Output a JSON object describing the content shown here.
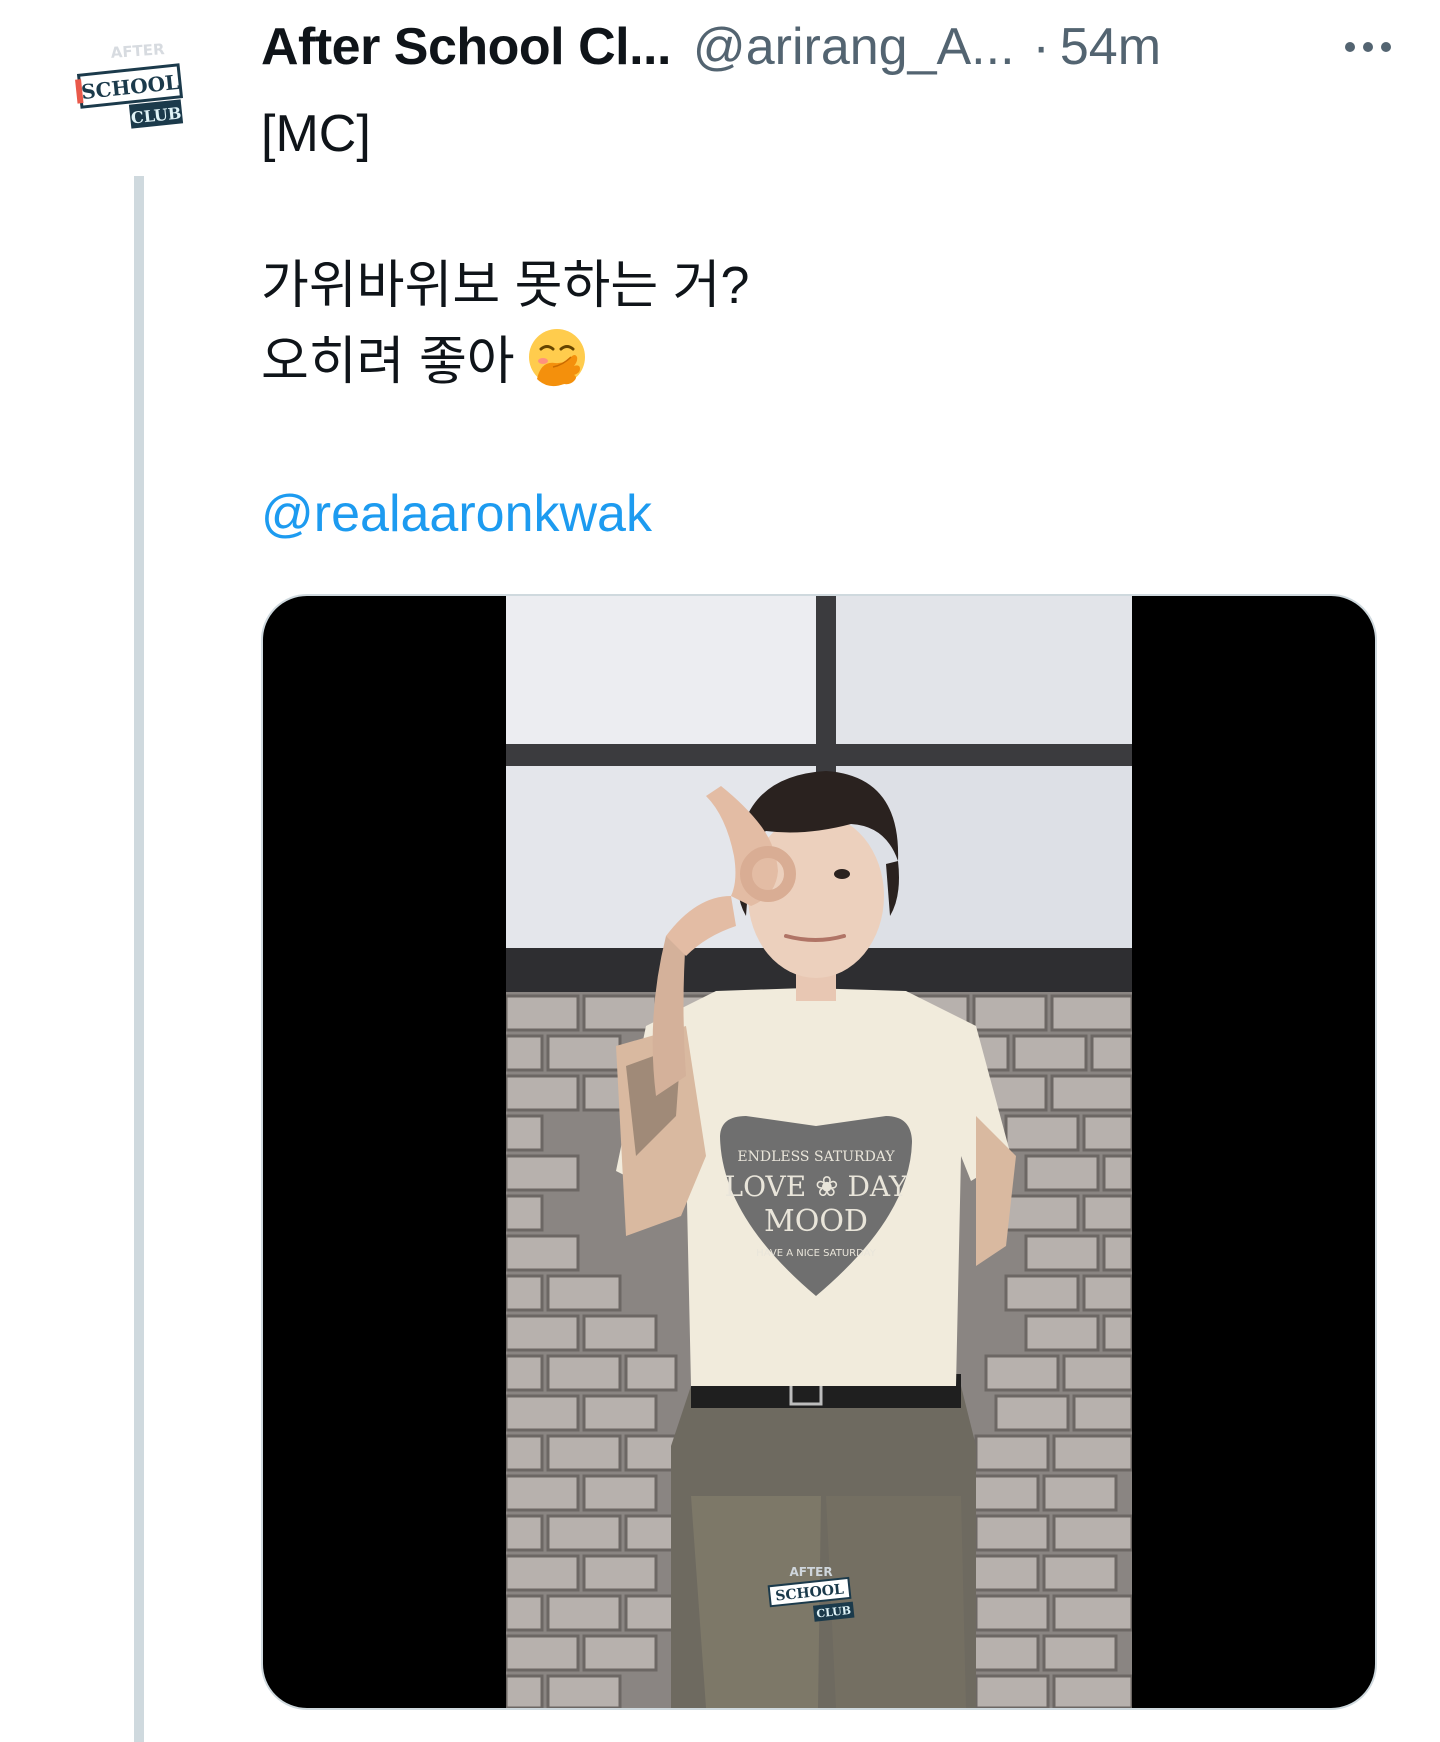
{
  "tweet": {
    "display_name": "After School Cl...",
    "handle": "@arirang_A...",
    "separator": "·",
    "time": "54m",
    "more_icon": "more-horizontal-icon",
    "text_lines": [
      "[MC]",
      "가위바위보 못하는 거?",
      "오히려 좋아"
    ],
    "emoji": "face-with-hand-over-mouth",
    "mention": "@realaaronkwak"
  },
  "avatar": {
    "logo_lines": [
      "AFTER",
      "SCHOOL",
      "CLUB"
    ]
  },
  "media": {
    "type": "video",
    "shirt_lines": [
      "ENDLESS SATURDAY",
      "LOVE ❀ DAY",
      "MOOD",
      "HAVE A NICE SATURDAY"
    ],
    "watermark_lines": [
      "AFTER",
      "SCHOOL",
      "CLUB"
    ]
  },
  "colors": {
    "accent": "#1d9bf0",
    "secondary_text": "#536471",
    "thread_line": "#cfd9de"
  }
}
